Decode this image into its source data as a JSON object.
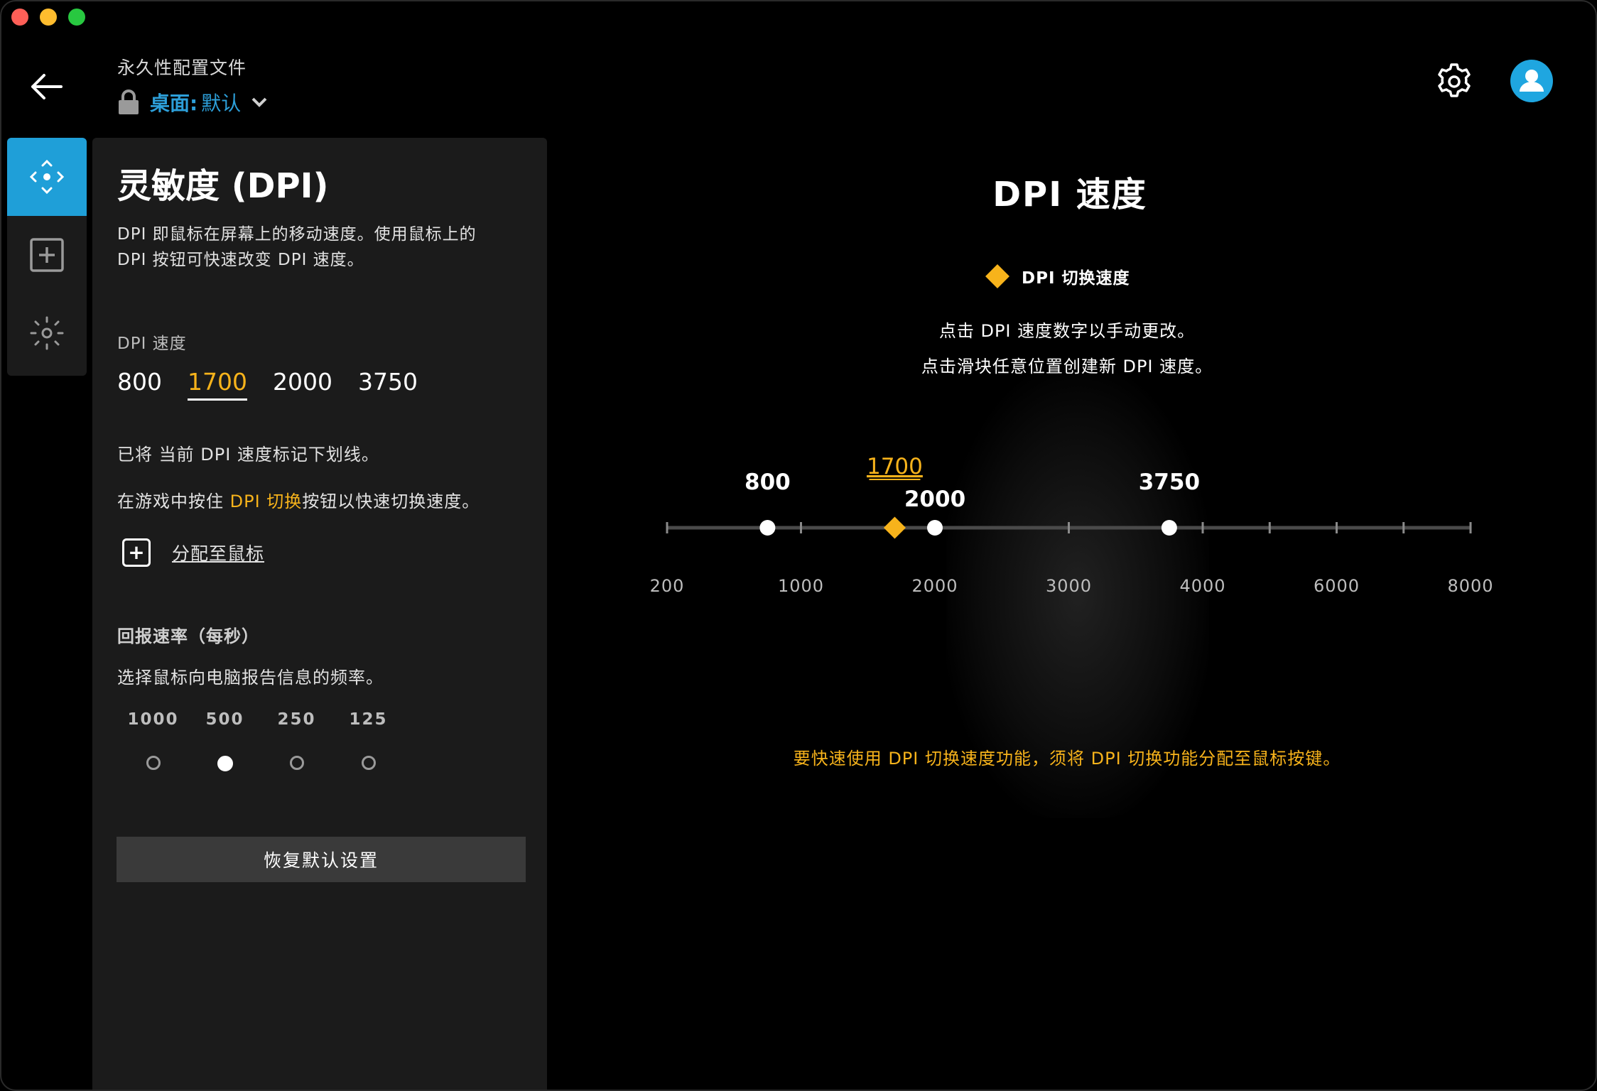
{
  "window": {
    "controls": [
      "close",
      "minimize",
      "maximize"
    ]
  },
  "header": {
    "back_icon": "arrow-left-icon",
    "profile_label": "永久性配置文件",
    "profile_key": "桌面:",
    "profile_value": "默认",
    "lock_icon": "lock-icon",
    "dropdown_icon": "chevron-down-icon",
    "settings_icon": "gear-icon",
    "account_icon": "user-avatar-icon"
  },
  "rail": {
    "items": [
      {
        "icon": "move-arrows-icon",
        "active": true
      },
      {
        "icon": "plus-square-icon",
        "active": false
      },
      {
        "icon": "lighting-sun-icon",
        "active": false
      }
    ]
  },
  "panel": {
    "title": "灵敏度 (DPI)",
    "description_line1": "DPI 即鼠标在屏幕上的移动速度。使用鼠标上的",
    "description_line2": "DPI 按钮可快速改变 DPI 速度。",
    "dpi_label": "DPI 速度",
    "dpi_values": [
      "800",
      "1700",
      "2000",
      "3750"
    ],
    "dpi_current_index": 1,
    "underline_note": "已将 当前 DPI 速度标记下划线。",
    "shift_note_prefix": "在游戏中按住 ",
    "shift_note_highlight": "DPI 切换",
    "shift_note_suffix": "按钮以快速切换速度。",
    "assign_icon": "plus-square-icon",
    "assign_label": "分配至鼠标",
    "rate_title": "回报速率（每秒）",
    "rate_desc": "选择鼠标向电脑报告信息的频率。",
    "rate_options": [
      "1000",
      "500",
      "250",
      "125"
    ],
    "rate_selected_index": 1,
    "reset_label": "恢复默认设置"
  },
  "main": {
    "title": "DPI 速度",
    "legend_label": "DPI 切换速度",
    "hint1": "点击 DPI 速度数字以手动更改。",
    "hint2": "点击滑块任意位置创建新 DPI 速度。",
    "warning": "要快速使用 DPI 切换速度功能，须将 DPI 切换功能分配至鼠标按键。",
    "accent_color": "#f7b31b",
    "brand_color": "#1f9fd8"
  },
  "slider": {
    "min": 200,
    "max": 8000,
    "scale_ticks": [
      200,
      1000,
      2000,
      3000,
      4000,
      6000,
      8000
    ],
    "scale_labels": [
      "200",
      "1000",
      "2000",
      "3000",
      "4000",
      "6000",
      "8000"
    ],
    "minor_ticks": [
      1000,
      3000,
      4000,
      5000,
      6000,
      7000,
      8000
    ],
    "dpi_points": [
      {
        "value": 800,
        "label": "800"
      },
      {
        "value": 2000,
        "label": "2000"
      },
      {
        "value": 3750,
        "label": "3750"
      }
    ],
    "shift_point": {
      "value": 1700,
      "label": "1700"
    }
  }
}
